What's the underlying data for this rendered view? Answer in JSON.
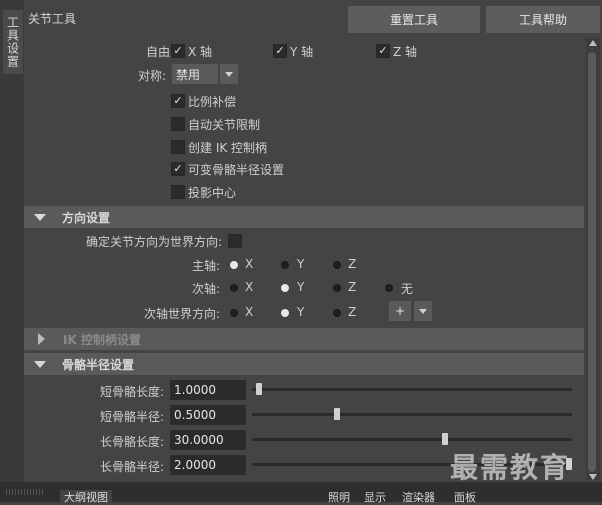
{
  "side_tab": "工具设置",
  "title": "关节工具",
  "buttons": {
    "reset": "重置工具",
    "help": "工具帮助"
  },
  "freedom": {
    "label": "自由度:",
    "x": "X 轴",
    "y": "Y 轴",
    "z": "Z 轴"
  },
  "symmetry": {
    "label": "对称:",
    "value": "禁用"
  },
  "options": [
    {
      "label": "比例补偿",
      "checked": true
    },
    {
      "label": "自动关节限制",
      "checked": false
    },
    {
      "label": "创建 IK 控制柄",
      "checked": false
    },
    {
      "label": "可变骨骼半径设置",
      "checked": true
    },
    {
      "label": "投影中心",
      "checked": false
    }
  ],
  "orient_section": {
    "title": "方向设置",
    "world_label": "确定关节方向为世界方向:",
    "primary_label": "主轴:",
    "secondary_label": "次轴:",
    "secondary_world_label": "次轴世界方向:",
    "x": "X",
    "y": "Y",
    "z": "Z",
    "none": "无",
    "plus": "+",
    "primary_selected": "X",
    "secondary_selected": "Y",
    "secondary_world_selected": "Y"
  },
  "ik_section": {
    "title": "IK 控制柄设置"
  },
  "bone_section": {
    "title": "骨骼半径设置",
    "fields": [
      {
        "label": "短骨骼长度:",
        "value": "1.0000",
        "slider_fraction": 0.0
      },
      {
        "label": "短骨骼半径:",
        "value": "0.5000",
        "slider_fraction": 0.25
      },
      {
        "label": "长骨骼长度:",
        "value": "30.0000",
        "slider_fraction": 0.6
      },
      {
        "label": "长骨骼半径:",
        "value": "2.0000",
        "slider_fraction": 1.0
      }
    ]
  },
  "bottom_tabs": {
    "outliner": "大纲视图",
    "light": "照明",
    "show": "显示",
    "renderer": "渲染器",
    "panel": "面板"
  },
  "watermark": "最需教育",
  "colors": {
    "panel_bg": "#444444",
    "section_bg": "#5a5a5a",
    "field_bg": "#2b2b2b",
    "button_bg": "#5d5d5d"
  }
}
